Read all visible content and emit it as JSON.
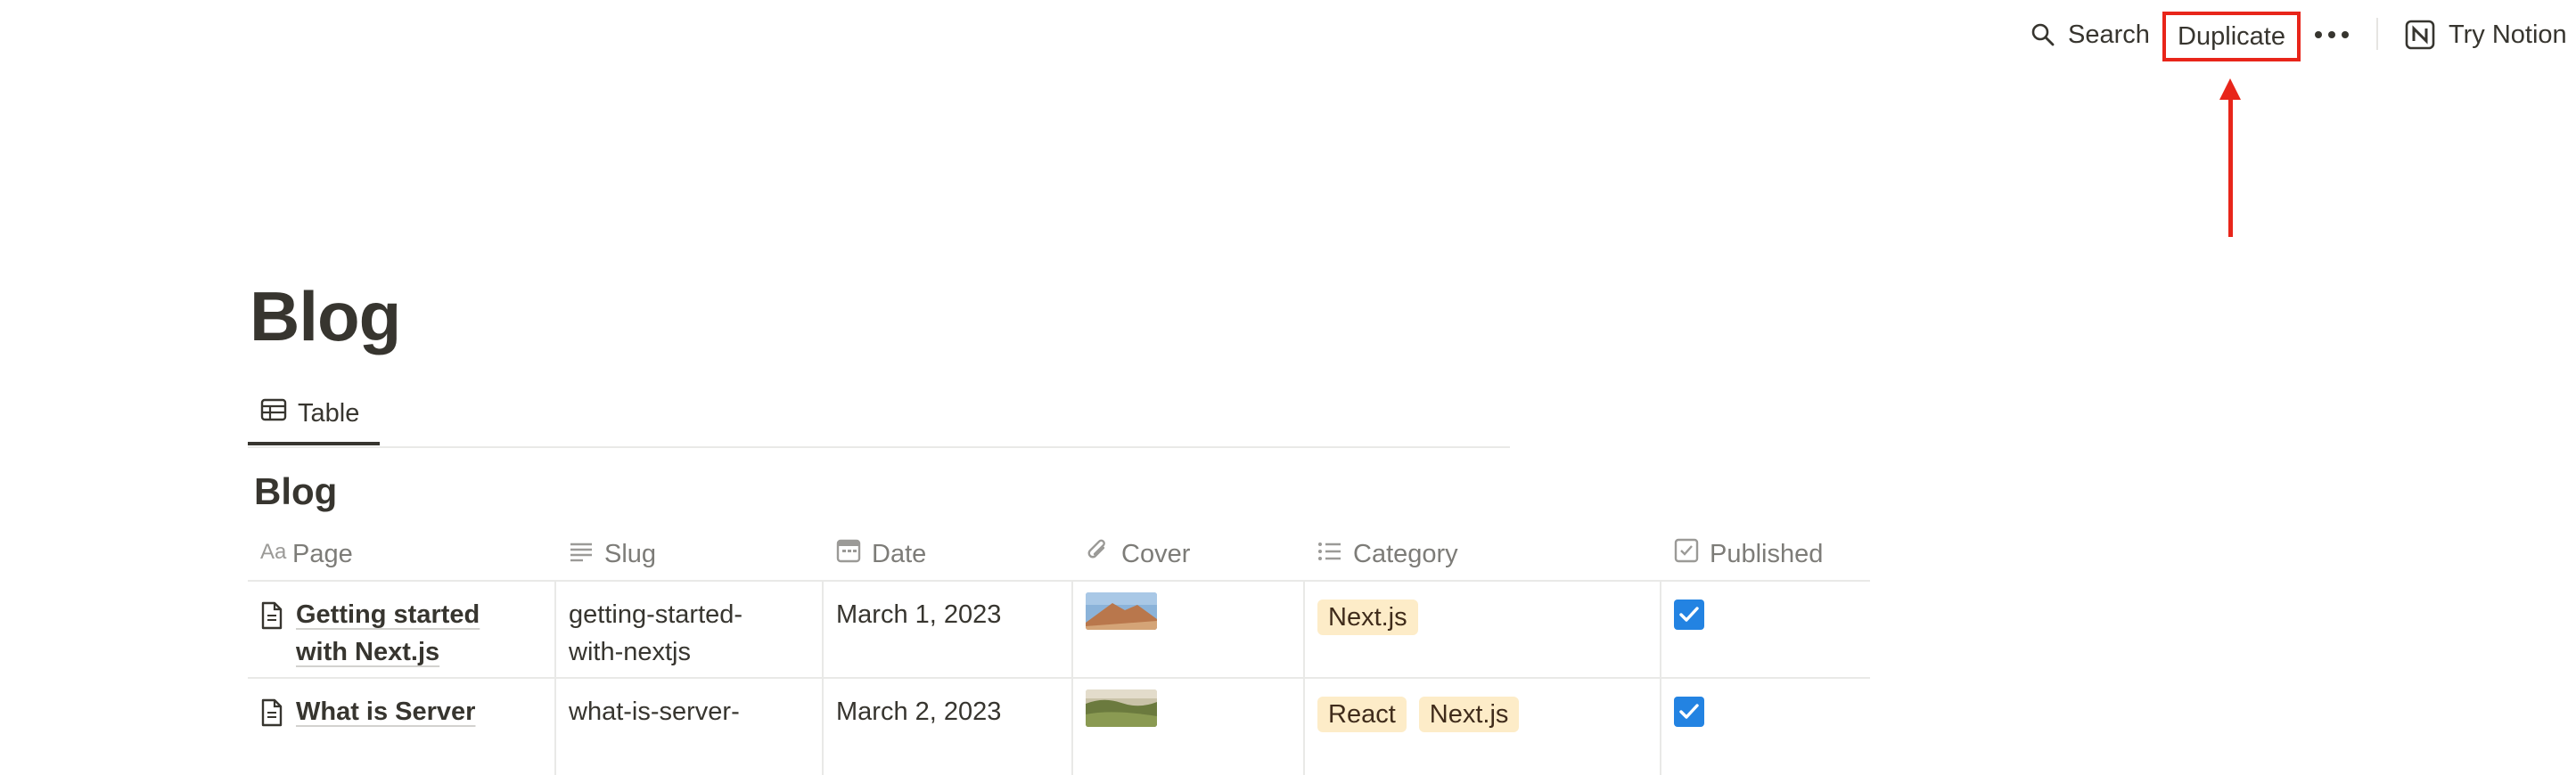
{
  "topbar": {
    "search_label": "Search",
    "duplicate_label": "Duplicate",
    "more_label": "•••",
    "try_label": "Try Notion",
    "highlight_color": "#e8251a"
  },
  "page": {
    "title": "Blog",
    "view_tab_label": "Table",
    "database_title": "Blog"
  },
  "table": {
    "columns": [
      {
        "label": "Page",
        "icon": "title-aa-icon"
      },
      {
        "label": "Slug",
        "icon": "text-lines-icon"
      },
      {
        "label": "Date",
        "icon": "calendar-icon"
      },
      {
        "label": "Cover",
        "icon": "paperclip-icon"
      },
      {
        "label": "Category",
        "icon": "list-icon"
      },
      {
        "label": "Published",
        "icon": "checkbox-icon"
      }
    ],
    "rows": [
      {
        "title_line1": "Getting started",
        "title_line2": "with Next.js",
        "slug_line1": "getting-started-",
        "slug_line2": "with-nextjs",
        "date": "March 1, 2023",
        "cover": "desert-cover-image",
        "categories": [
          "Next.js"
        ],
        "published": true
      },
      {
        "title_line1": "What is Server",
        "title_line2": "",
        "slug_line1": "what-is-server-",
        "slug_line2": "",
        "date": "March 2, 2023",
        "cover": "landscape-cover-image",
        "categories": [
          "React",
          "Next.js"
        ],
        "published": true
      }
    ]
  },
  "colors": {
    "tag_bg": "#fdecc8",
    "tag_text": "#402c1b",
    "checkbox": "#2383e2",
    "text": "#37352f",
    "muted": "#7d7c78"
  }
}
